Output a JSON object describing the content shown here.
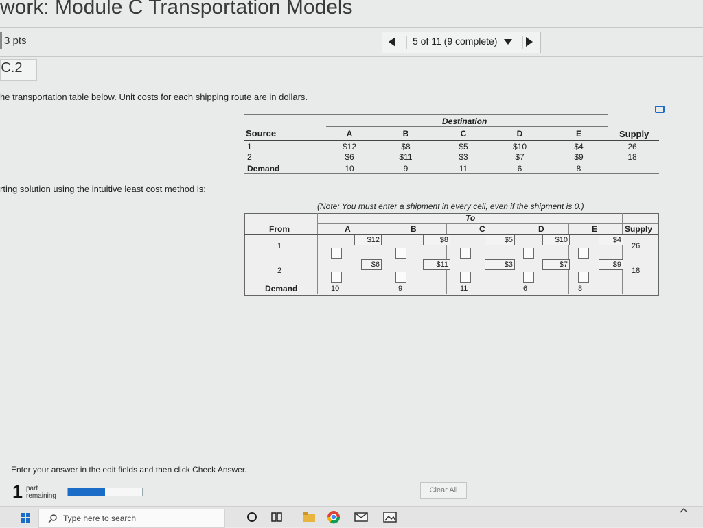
{
  "header": {
    "title": "work: Module C Transportation Models",
    "points": "3 pts",
    "nav_label": "5 of 11 (9 complete)",
    "question_id": "C.2"
  },
  "prompt": {
    "line1": "he transportation table below. Unit costs for each shipping route are in dollars.",
    "line2": "rting solution using the intuitive least cost method is:"
  },
  "source_table": {
    "destination_label": "Destination",
    "source_label": "Source",
    "supply_label": "Supply",
    "demand_label": "Demand",
    "columns": [
      "A",
      "B",
      "C",
      "D",
      "E"
    ],
    "rows": [
      {
        "label": "1",
        "costs": [
          "$12",
          "$8",
          "$5",
          "$10",
          "$4"
        ],
        "supply": "26"
      },
      {
        "label": "2",
        "costs": [
          "$6",
          "$11",
          "$3",
          "$7",
          "$9"
        ],
        "supply": "18"
      }
    ],
    "demand": [
      "10",
      "9",
      "11",
      "6",
      "8"
    ]
  },
  "answer_table": {
    "note": "(Note: You must enter a shipment in every cell, even if the shipment is 0.)",
    "to_label": "To",
    "from_label": "From",
    "supply_label": "Supply",
    "demand_label": "Demand",
    "columns": [
      "A",
      "B",
      "C",
      "D",
      "E"
    ],
    "rows": [
      {
        "label": "1",
        "costs": [
          "$12",
          "$8",
          "$5",
          "$10",
          "$4"
        ],
        "supply": "26"
      },
      {
        "label": "2",
        "costs": [
          "$6",
          "$11",
          "$3",
          "$7",
          "$9"
        ],
        "supply": "18"
      }
    ],
    "demand": [
      "10",
      "9",
      "11",
      "6",
      "8"
    ]
  },
  "footer": {
    "instructions": "Enter your answer in the edit fields and then click Check Answer.",
    "parts_count": "1",
    "parts_label_1": "part",
    "parts_label_2": "remaining",
    "progress_fraction": 0.5,
    "clear_all": "Clear All"
  },
  "taskbar": {
    "search_placeholder": "Type here to search"
  }
}
